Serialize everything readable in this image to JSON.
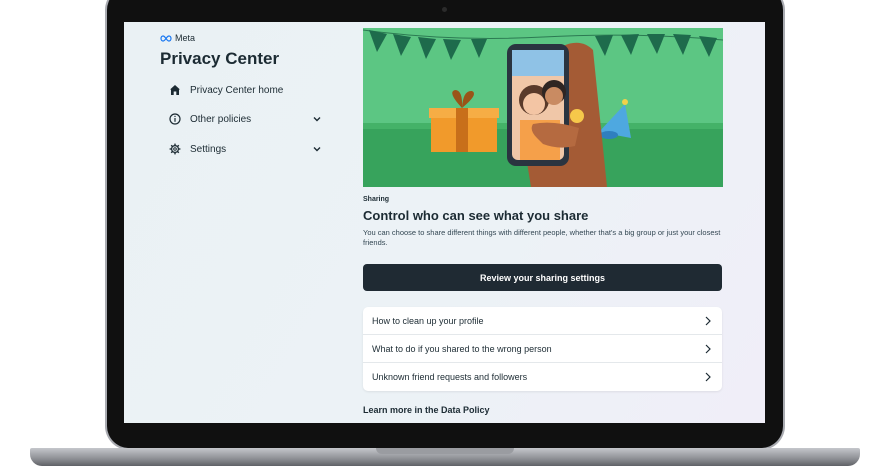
{
  "brand": {
    "name": "Meta"
  },
  "sidebar": {
    "title": "Privacy Center",
    "items": [
      {
        "label": "Privacy Center home",
        "icon": "home-icon",
        "has_chevron": false
      },
      {
        "label": "Other policies",
        "icon": "info-icon",
        "has_chevron": true
      },
      {
        "label": "Settings",
        "icon": "gear-icon",
        "has_chevron": true
      }
    ]
  },
  "main": {
    "eyebrow": "Sharing",
    "heading": "Control who can see what you share",
    "description": "You can choose to share different things with different people, whether that's a big group or just your closest friends.",
    "cta_label": "Review your sharing settings",
    "links": [
      "How to clean up your profile",
      "What to do if you shared to the wrong person",
      "Unknown friend requests and followers"
    ],
    "learn_more": "Learn more in the Data Policy"
  },
  "colors": {
    "text": "#1c2b33",
    "cta_bg": "#1f2a33",
    "hero_green": "#58bf7e",
    "bunting": "#1e6b4c"
  }
}
